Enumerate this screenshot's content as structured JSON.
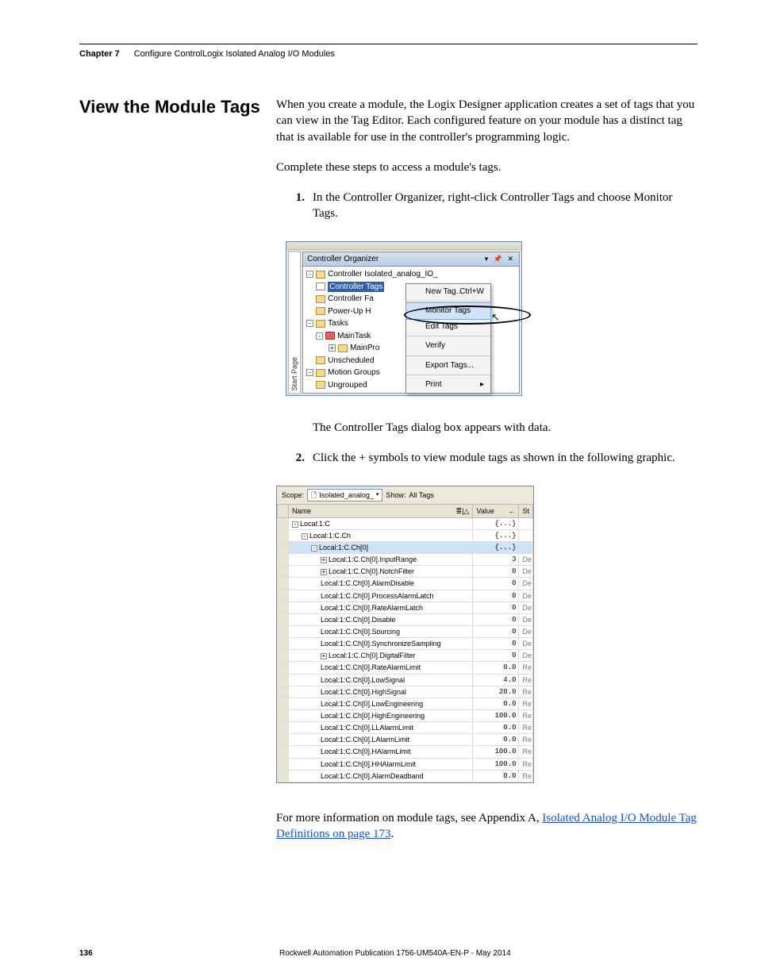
{
  "header": {
    "chapter": "Chapter 7",
    "title": "Configure ControlLogix Isolated Analog I/O Modules"
  },
  "sectionTitle": "View the Module Tags",
  "intro": "When you create a module, the Logix Designer application creates a set of tags that you can view in the Tag Editor. Each configured feature on your module has a distinct tag that is available for use in the controller's programming logic.",
  "preSteps": "Complete these steps to access a module's tags.",
  "step1": {
    "num": "1.",
    "text": "In the Controller Organizer, right-click Controller Tags and choose Monitor Tags."
  },
  "afterShot1": "The Controller Tags dialog box appears with data.",
  "step2": {
    "num": "2.",
    "text": "Click the + symbols to view module tags as shown in the following graphic."
  },
  "shot1": {
    "startPage": "Start Page",
    "orgTitle": "Controller Organizer",
    "pinClose": "▾ ✕",
    "tree": {
      "controller": "Controller Isolated_analog_IO_",
      "controllerTags": "Controller Tags",
      "controllerFa": "Controller Fa",
      "powerUp": "Power-Up H",
      "tasks": "Tasks",
      "mainTask": "MainTask",
      "mainPro": "MainPro",
      "unscheduled": "Unscheduled",
      "motionGroups": "Motion Groups",
      "ungrouped": "Ungrouped"
    },
    "menu": {
      "newTag": "New Tag...",
      "newTagSc": "Ctrl+W",
      "monitor": "Monitor Tags",
      "edit": "Edit Tags",
      "verify": "Verify",
      "export": "Export Tags...",
      "print": "Print"
    }
  },
  "shot2": {
    "scopeLabel": "Scope:",
    "scopeVal": "Isolated_analog_",
    "showLabel": "Show:",
    "showVal": "All Tags",
    "headers": {
      "name": "Name",
      "value": "Value",
      "st": "St"
    },
    "rows": [
      {
        "i": 0,
        "e": "-",
        "name": "Local:1:C",
        "v": "{...}",
        "t": ""
      },
      {
        "i": 1,
        "e": "-",
        "name": "Local:1:C.Ch",
        "v": "{...}",
        "t": ""
      },
      {
        "i": 2,
        "e": "-",
        "name": "Local:1:C.Ch[0]",
        "v": "{...}",
        "t": "",
        "sel": true
      },
      {
        "i": 3,
        "e": "+",
        "name": "Local:1:C.Ch[0].InputRange",
        "v": "3",
        "t": "De"
      },
      {
        "i": 3,
        "e": "+",
        "name": "Local:1:C.Ch[0].NotchFilter",
        "v": "0",
        "t": "De"
      },
      {
        "i": 3,
        "e": "",
        "name": "Local:1:C.Ch[0].AlarmDisable",
        "v": "0",
        "t": "De"
      },
      {
        "i": 3,
        "e": "",
        "name": "Local:1:C.Ch[0].ProcessAlarmLatch",
        "v": "0",
        "t": "De"
      },
      {
        "i": 3,
        "e": "",
        "name": "Local:1:C.Ch[0].RateAlarmLatch",
        "v": "0",
        "t": "De"
      },
      {
        "i": 3,
        "e": "",
        "name": "Local:1:C.Ch[0].Disable",
        "v": "0",
        "t": "De"
      },
      {
        "i": 3,
        "e": "",
        "name": "Local:1:C.Ch[0].Sourcing",
        "v": "0",
        "t": "De"
      },
      {
        "i": 3,
        "e": "",
        "name": "Local:1:C.Ch[0].SynchronizeSampling",
        "v": "0",
        "t": "De"
      },
      {
        "i": 3,
        "e": "+",
        "name": "Local:1:C.Ch[0].DigitalFilter",
        "v": "0",
        "t": "De"
      },
      {
        "i": 3,
        "e": "",
        "name": "Local:1:C.Ch[0].RateAlarmLimit",
        "v": "0.0",
        "t": "Re"
      },
      {
        "i": 3,
        "e": "",
        "name": "Local:1:C.Ch[0].LowSignal",
        "v": "4.0",
        "t": "Re"
      },
      {
        "i": 3,
        "e": "",
        "name": "Local:1:C.Ch[0].HighSignal",
        "v": "20.0",
        "t": "Re"
      },
      {
        "i": 3,
        "e": "",
        "name": "Local:1:C.Ch[0].LowEngineering",
        "v": "0.0",
        "t": "Re"
      },
      {
        "i": 3,
        "e": "",
        "name": "Local:1:C.Ch[0].HighEngineering",
        "v": "100.0",
        "t": "Re"
      },
      {
        "i": 3,
        "e": "",
        "name": "Local:1:C.Ch[0].LLAlarmLimit",
        "v": "0.0",
        "t": "Re"
      },
      {
        "i": 3,
        "e": "",
        "name": "Local:1:C.Ch[0].LAlarmLimit",
        "v": "0.0",
        "t": "Re"
      },
      {
        "i": 3,
        "e": "",
        "name": "Local:1:C.Ch[0].HAlarmLimit",
        "v": "100.0",
        "t": "Re"
      },
      {
        "i": 3,
        "e": "",
        "name": "Local:1:C.Ch[0].HHAlarmLimit",
        "v": "100.0",
        "t": "Re"
      },
      {
        "i": 3,
        "e": "",
        "name": "Local:1:C.Ch[0].AlarmDeadband",
        "v": "0.0",
        "t": "Re"
      }
    ]
  },
  "closingPre": "For more information on module tags, see Appendix A, ",
  "closingLink": "Isolated Analog I/O Module Tag Definitions on page 173",
  "closingPost": ".",
  "footer": {
    "page": "136",
    "pub": "Rockwell Automation Publication 1756-UM540A-EN-P - May 2014"
  }
}
